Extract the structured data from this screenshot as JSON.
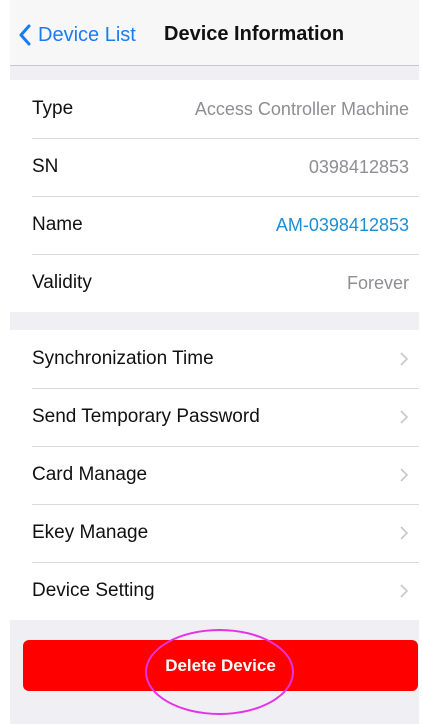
{
  "nav": {
    "back_label": "Device List",
    "title": "Device Information"
  },
  "info": [
    {
      "label": "Type",
      "value": "Access Controller Machine"
    },
    {
      "label": "SN",
      "value": "0398412853"
    },
    {
      "label": "Name",
      "value": "AM-0398412853"
    },
    {
      "label": "Validity",
      "value": "Forever"
    }
  ],
  "menu": [
    {
      "label": "Synchronization Time"
    },
    {
      "label": "Send Temporary Password"
    },
    {
      "label": "Card Manage"
    },
    {
      "label": "Ekey Manage"
    },
    {
      "label": "Device Setting"
    }
  ],
  "delete_label": "Delete Device",
  "colors": {
    "accent": "#1a7cf2",
    "link": "#1d8fd1",
    "danger": "#ff0000",
    "highlight_ring": "#e632e6"
  },
  "icons": {
    "back": "chevron-left-icon",
    "row_disclosure": "chevron-right-icon"
  }
}
